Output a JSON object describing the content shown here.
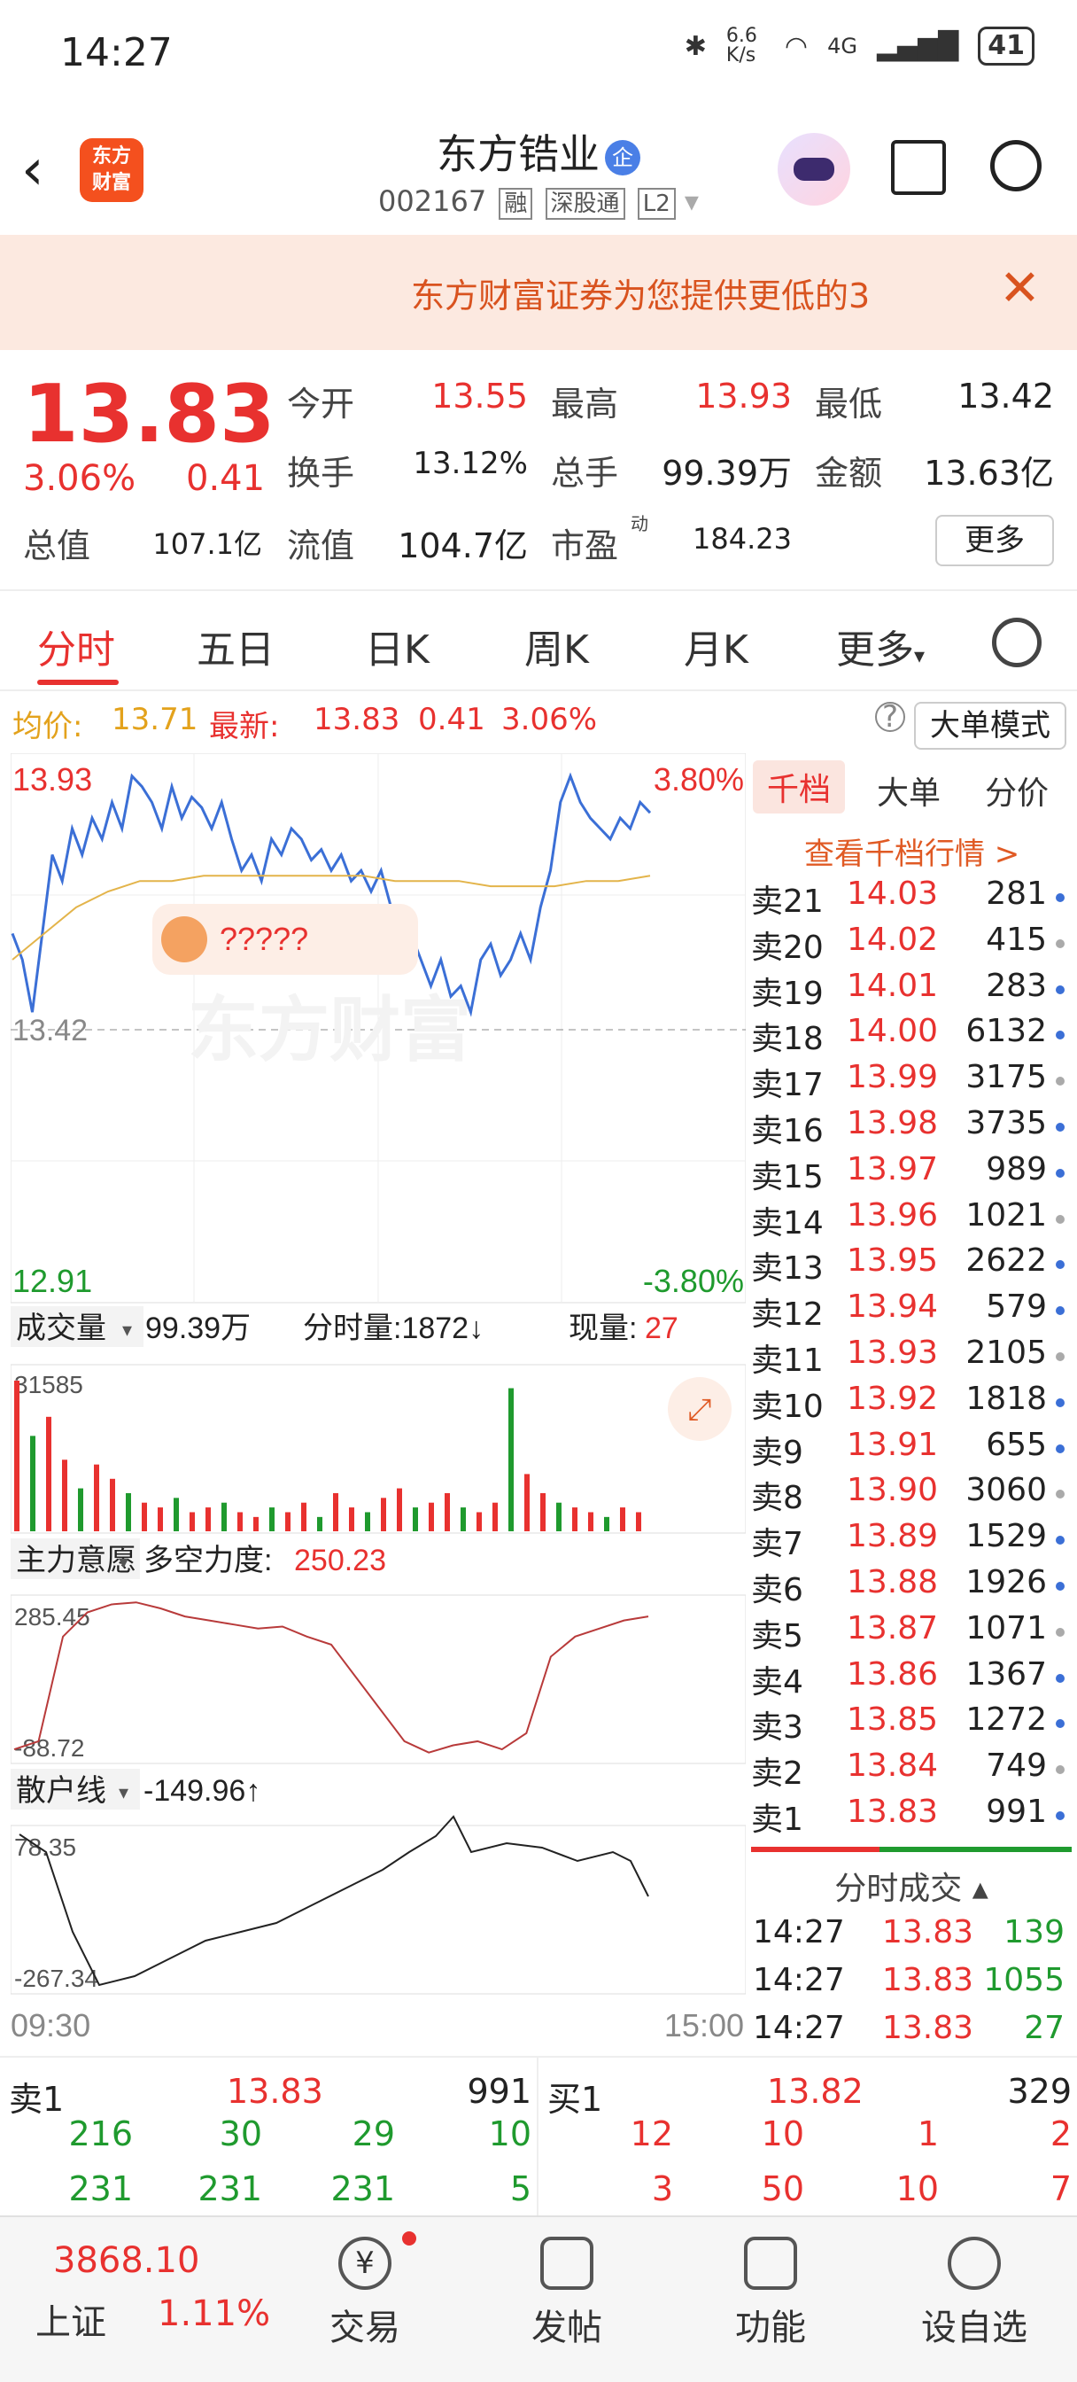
{
  "status_bar": {
    "time": "14:27",
    "net_speed": "6.6 K/s",
    "signal": "4G",
    "battery": "41"
  },
  "header": {
    "stock_name": "东方锆业",
    "badge": "企",
    "code": "002167",
    "tags": [
      "融",
      "深股通",
      "L2"
    ],
    "logo_text": "东方\n财富"
  },
  "banner": {
    "text": "东方财富证券为您提供更低的3",
    "close": "✕"
  },
  "quote": {
    "price": "13.83",
    "change_pct": "3.06%",
    "change": "0.41",
    "open_label": "今开",
    "open": "13.55",
    "high_label": "最高",
    "high": "13.93",
    "low_label": "最低",
    "low": "13.42",
    "turnover_label": "换手",
    "turnover": "13.12%",
    "volume_label": "总手",
    "volume": "99.39万",
    "amount_label": "金额",
    "amount": "13.63亿",
    "mktcap_label": "总值",
    "mktcap": "107.1亿",
    "float_label": "流值",
    "float": "104.7亿",
    "pe_label": "市盈",
    "pe_sup": "动",
    "pe": "184.23",
    "more": "更多"
  },
  "tabs": [
    "分时",
    "五日",
    "日K",
    "周K",
    "月K",
    "更多"
  ],
  "avg_bar": {
    "avg_label": "均价:",
    "avg": "13.71",
    "latest_label": "最新:",
    "latest": "13.83",
    "change": "0.41",
    "pct": "3.06%",
    "mode": "大单模式"
  },
  "chart": {
    "price_high": "13.93",
    "price_low": "12.91",
    "pct_high": "3.80%",
    "pct_low": "-3.80%",
    "ref_price": "13.42",
    "bubble_text": "?????",
    "watermark": "东方财富",
    "vol_label": "成交量",
    "vol_total": "99.39万",
    "tick_vol": "分时量:1872↓",
    "cur_vol_label": "现量:",
    "cur_vol": "27",
    "vol_max": "31585",
    "ind1_label": "主力意愿",
    "ind1_name": "多空力度:",
    "ind1_value": "250.23",
    "ind1_max": "285.45",
    "ind1_min": "-88.72",
    "ind2_label": "散户线",
    "ind2_value": "-149.96↑",
    "ind2_max": "78.35",
    "ind2_min": "-267.34",
    "time_start": "09:30",
    "time_end": "15:00"
  },
  "chart_data": {
    "type": "line",
    "title": "",
    "ylim": [
      12.91,
      13.93
    ],
    "series": [
      {
        "values": [
          13.6,
          13.55,
          13.45,
          13.6,
          13.75,
          13.7,
          13.8,
          13.75,
          13.82,
          13.78,
          13.85,
          13.8,
          13.9,
          13.88,
          13.85,
          13.8,
          13.88,
          13.82,
          13.86,
          13.84,
          13.8,
          13.85,
          13.78,
          13.72,
          13.75,
          13.7,
          13.78,
          13.75,
          13.8,
          13.78,
          13.74,
          13.76,
          13.72,
          13.75,
          13.7,
          13.72,
          13.68,
          13.72,
          13.65,
          13.55,
          13.6,
          13.55,
          13.5,
          13.55,
          13.48,
          13.5,
          13.45,
          13.55,
          13.58,
          13.52,
          13.55,
          13.6,
          13.55,
          13.65,
          13.72,
          13.85,
          13.9,
          13.85,
          13.82,
          13.8,
          13.78,
          13.82,
          13.8,
          13.85,
          13.83
        ]
      },
      {
        "values": [
          13.55,
          13.6,
          13.65,
          13.68,
          13.7,
          13.7,
          13.71,
          13.71,
          13.71,
          13.71,
          13.71,
          13.71,
          13.7,
          13.7,
          13.7,
          13.69,
          13.69,
          13.69,
          13.7,
          13.7,
          13.71
        ]
      }
    ],
    "volume_bars": [
      31585,
      20000,
      24000,
      15000,
      9000,
      14000,
      11000,
      8000,
      6000,
      5000,
      7000,
      4000,
      5000,
      6000,
      4000,
      3000,
      5000,
      4000,
      6000,
      3000,
      8000,
      5000,
      4000,
      7000,
      9000,
      5000,
      6000,
      8000,
      5000,
      4000,
      6000,
      30000,
      12000,
      8000,
      6000,
      5000,
      4000,
      3000,
      5000,
      4000
    ],
    "indicator1": [
      -80,
      -60,
      200,
      260,
      280,
      285,
      270,
      250,
      240,
      230,
      220,
      225,
      200,
      180,
      100,
      20,
      -60,
      -88,
      -70,
      -60,
      -80,
      -40,
      150,
      200,
      220,
      240,
      250
    ]
  },
  "orderbook": {
    "tabs": [
      "千档",
      "大单",
      "分价"
    ],
    "link": "查看千档行情 >",
    "rows": [
      {
        "label": "卖21",
        "price": "14.03",
        "vol": "281"
      },
      {
        "label": "卖20",
        "price": "14.02",
        "vol": "415"
      },
      {
        "label": "卖19",
        "price": "14.01",
        "vol": "283"
      },
      {
        "label": "卖18",
        "price": "14.00",
        "vol": "6132"
      },
      {
        "label": "卖17",
        "price": "13.99",
        "vol": "3175"
      },
      {
        "label": "卖16",
        "price": "13.98",
        "vol": "3735"
      },
      {
        "label": "卖15",
        "price": "13.97",
        "vol": "989"
      },
      {
        "label": "卖14",
        "price": "13.96",
        "vol": "1021"
      },
      {
        "label": "卖13",
        "price": "13.95",
        "vol": "2622"
      },
      {
        "label": "卖12",
        "price": "13.94",
        "vol": "579"
      },
      {
        "label": "卖11",
        "price": "13.93",
        "vol": "2105"
      },
      {
        "label": "卖10",
        "price": "13.92",
        "vol": "1818"
      },
      {
        "label": "卖9",
        "price": "13.91",
        "vol": "655"
      },
      {
        "label": "卖8",
        "price": "13.90",
        "vol": "3060"
      },
      {
        "label": "卖7",
        "price": "13.89",
        "vol": "1529"
      },
      {
        "label": "卖6",
        "price": "13.88",
        "vol": "1926"
      },
      {
        "label": "卖5",
        "price": "13.87",
        "vol": "1071"
      },
      {
        "label": "卖4",
        "price": "13.86",
        "vol": "1367"
      },
      {
        "label": "卖3",
        "price": "13.85",
        "vol": "1272"
      },
      {
        "label": "卖2",
        "price": "13.84",
        "vol": "749"
      },
      {
        "label": "卖1",
        "price": "13.83",
        "vol": "991"
      }
    ],
    "trades_title": "分时成交",
    "trades": [
      {
        "time": "14:27",
        "price": "13.83",
        "vol": "139"
      },
      {
        "time": "14:27",
        "price": "13.83",
        "vol": "1055"
      },
      {
        "time": "14:27",
        "price": "13.83",
        "vol": "27"
      }
    ]
  },
  "bottom_quote": {
    "sell_label": "卖1",
    "sell_price": "13.83",
    "sell_vol": "991",
    "buy_label": "买1",
    "buy_price": "13.82",
    "buy_vol": "329",
    "sell_row1": [
      "216",
      "30",
      "29",
      "10"
    ],
    "sell_row2": [
      "231",
      "231",
      "231",
      "5"
    ],
    "buy_row1": [
      "12",
      "10",
      "1",
      "2"
    ],
    "buy_row2": [
      "3",
      "50",
      "10",
      "7"
    ]
  },
  "bottom_bar": {
    "index_value": "3868.10",
    "index_name": "上证",
    "index_pct": "1.11%",
    "items": [
      "交易",
      "发帖",
      "功能",
      "设自选"
    ]
  }
}
